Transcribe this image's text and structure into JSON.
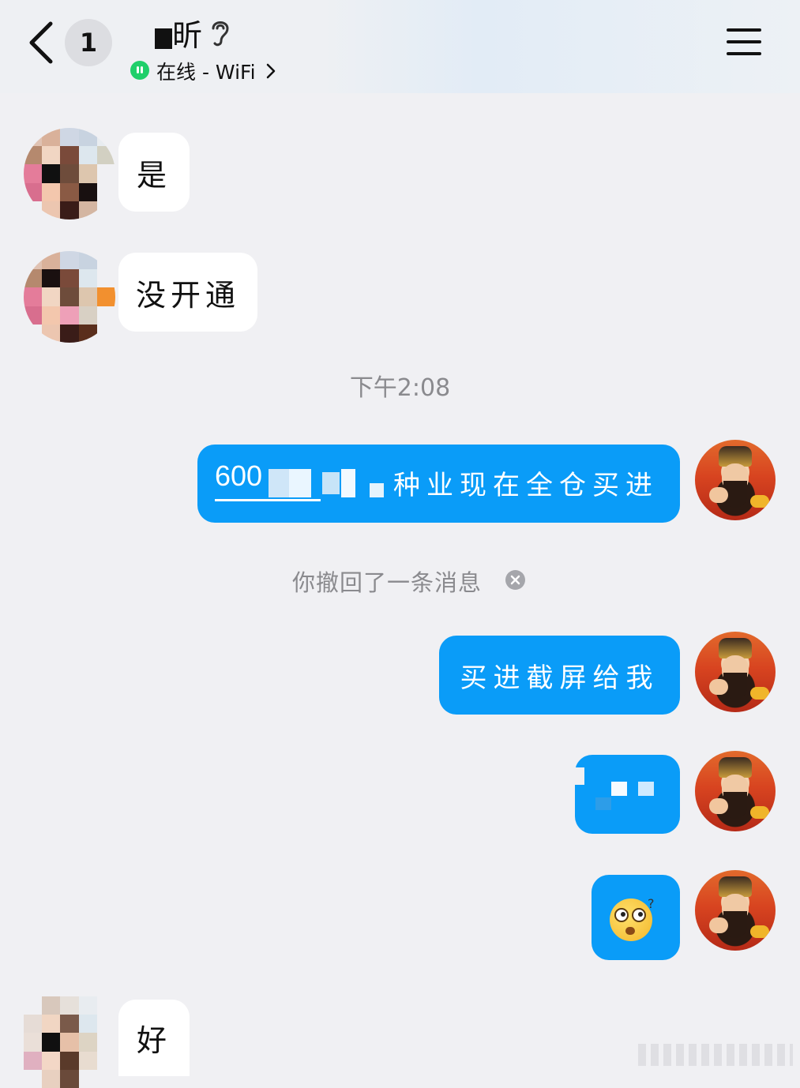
{
  "header": {
    "unread_count": "1",
    "contact_name": "昕",
    "status": "在线 - WiFi"
  },
  "messages": {
    "m1": "是",
    "m2": "没开通",
    "timestamp": "下午2:08",
    "m3_code_prefix": "600",
    "m3_text": "种业现在全仓买进",
    "recall_notice": "你撤回了一条消息",
    "m4": "买进截屏给我",
    "m7": "好"
  },
  "colors": {
    "outgoing_bubble": "#0a9cf8",
    "incoming_bubble": "#ffffff",
    "background": "#f0f0f3",
    "online": "#1fcf6a"
  },
  "icons": [
    "chevron-left-icon",
    "ear-icon",
    "online-status-icon",
    "chevron-right-icon",
    "menu-icon",
    "close-icon",
    "emoji-thinking-icon"
  ]
}
